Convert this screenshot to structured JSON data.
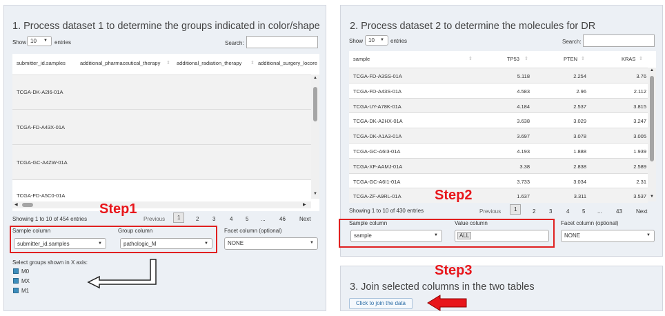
{
  "panel1": {
    "title": "1. Process dataset 1 to determine the groups indicated in color/shape",
    "show_label": "Show",
    "entries_value": "10",
    "entries_label": "entries",
    "search_label": "Search:",
    "columns": [
      "submitter_id.samples",
      "additional_pharmaceutical_therapy",
      "additional_radiation_therapy",
      "additional_surgery_locore"
    ],
    "rows": [
      "TCGA-DK-A2I6-01A",
      "TCGA-FD-A43X-01A",
      "TCGA-GC-A4ZW-01A",
      "TCGA-FD-A5C0-01A"
    ],
    "info": "Showing 1 to 10 of 454 entries",
    "pagination": {
      "previous": "Previous",
      "pages": [
        "1",
        "2",
        "3",
        "4",
        "5",
        "...",
        "46"
      ],
      "next": "Next"
    },
    "sample_column_label": "Sample column",
    "sample_column_value": "submitter_id.samples",
    "group_column_label": "Group column",
    "group_column_value": "pathologic_M",
    "facet_column_label": "Facet column (optional)",
    "facet_column_value": "NONE",
    "groups_label": "Select groups shown in X axis:",
    "groups": [
      "M0",
      "MX",
      "M1"
    ]
  },
  "panel2": {
    "title": "2. Process dataset 2 to determine the molecules for DR",
    "show_label": "Show",
    "entries_value": "10",
    "entries_label": "entries",
    "search_label": "Search:",
    "columns": [
      "sample",
      "TP53",
      "PTEN",
      "KRAS"
    ],
    "rows": [
      [
        "TCGA-FD-A3SS-01A",
        "5.118",
        "2.254",
        "3.76"
      ],
      [
        "TCGA-FD-A43S-01A",
        "4.583",
        "2.96",
        "2.112"
      ],
      [
        "TCGA-UY-A78K-01A",
        "4.184",
        "2.537",
        "3.815"
      ],
      [
        "TCGA-DK-A2HX-01A",
        "3.638",
        "3.029",
        "3.247"
      ],
      [
        "TCGA-DK-A1A3-01A",
        "3.697",
        "3.078",
        "3.005"
      ],
      [
        "TCGA-GC-A6I3-01A",
        "4.193",
        "1.888",
        "1.939"
      ],
      [
        "TCGA-XF-AAMJ-01A",
        "3.38",
        "2.838",
        "2.589"
      ],
      [
        "TCGA-GC-A6I1-01A",
        "3.733",
        "3.034",
        "2.31"
      ],
      [
        "TCGA-ZF-A9RL-01A",
        "1.637",
        "3.311",
        "3.537"
      ]
    ],
    "info": "Showing 1 to 10 of 430 entries",
    "pagination": {
      "previous": "Previous",
      "pages": [
        "1",
        "2",
        "3",
        "4",
        "5",
        "...",
        "43"
      ],
      "next": "Next"
    },
    "sample_column_label": "Sample column",
    "sample_column_value": "sample",
    "value_column_label": "Value column",
    "value_column_value": "ALL",
    "facet_column_label": "Facet column (optional)",
    "facet_column_value": "NONE"
  },
  "panel3": {
    "title": "3. Join selected columns in the two tables",
    "button": "Click to join the data"
  },
  "annotations": {
    "step1": "Step1",
    "step2": "Step2",
    "step3": "Step3",
    "color": "#e8161b"
  }
}
